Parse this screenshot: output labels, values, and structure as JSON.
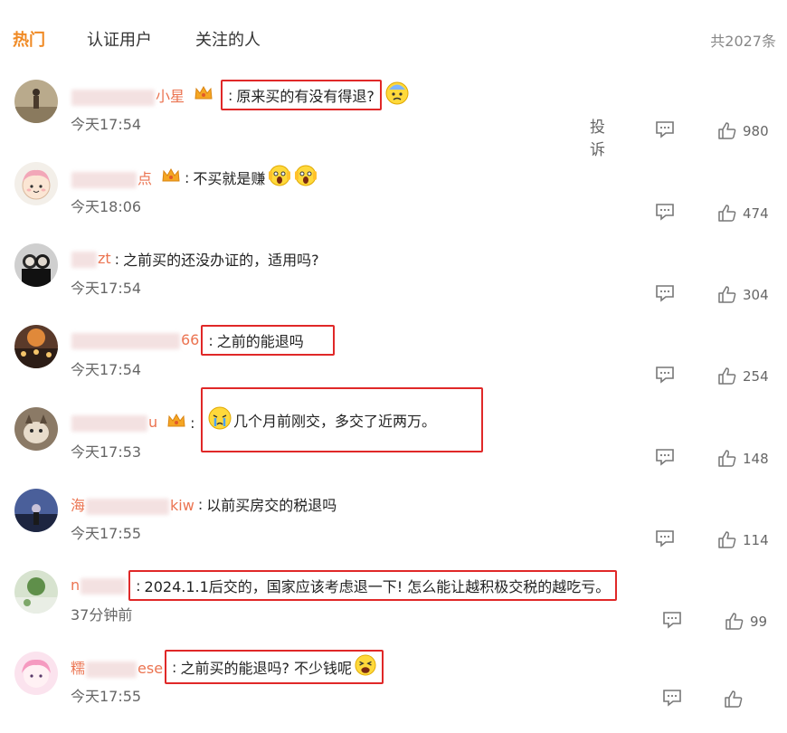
{
  "tabs": [
    {
      "label": "热门",
      "active": true
    },
    {
      "label": "认证用户",
      "active": false
    },
    {
      "label": "关注的人",
      "active": false
    }
  ],
  "total_label": "共2027条",
  "report_label": "投诉",
  "colors": {
    "accent": "#f08a24",
    "username": "#eb7350",
    "highlight_box": "#e02828"
  },
  "comments": [
    {
      "user_visible": "小星",
      "text": "原来买的有没有得退?",
      "time": "今天17:54",
      "likes": "980",
      "crown": true,
      "emoji": "cold-sweat-emoji",
      "highlighted": true
    },
    {
      "user_visible": "点",
      "text": "不买就是赚",
      "time": "今天18:06",
      "likes": "474",
      "crown": true,
      "emoji": "screaming-emoji",
      "highlighted": false
    },
    {
      "user_visible": "zt",
      "text": "之前买的还没办证的，适用吗?",
      "time": "今天17:54",
      "likes": "304",
      "crown": false,
      "emoji": "",
      "highlighted": false
    },
    {
      "user_visible": "66",
      "text": "之前的能退吗",
      "time": "今天17:54",
      "likes": "254",
      "crown": false,
      "emoji": "",
      "highlighted": true
    },
    {
      "user_visible": "u",
      "text": "几个月前刚交，多交了近两万。",
      "time": "今天17:53",
      "likes": "148",
      "crown": true,
      "emoji": "crying-emoji",
      "highlighted": true
    },
    {
      "user_visible": "海",
      "user_visible_suffix": "kiw",
      "text": "以前买房交的税退吗",
      "time": "今天17:55",
      "likes": "114",
      "crown": false,
      "emoji": "",
      "highlighted": false
    },
    {
      "user_visible": "n",
      "text": "2024.1.1后交的，国家应该考虑退一下! 怎么能让越积极交税的越吃亏。",
      "time": "37分钟前",
      "likes": "99",
      "crown": false,
      "emoji": "",
      "highlighted": true
    },
    {
      "user_visible": "糯",
      "user_visible_suffix": "ese",
      "text": "之前买的能退吗? 不少钱呢",
      "time": "今天17:55",
      "likes": "",
      "crown": false,
      "emoji": "weary-emoji",
      "highlighted": true
    }
  ]
}
